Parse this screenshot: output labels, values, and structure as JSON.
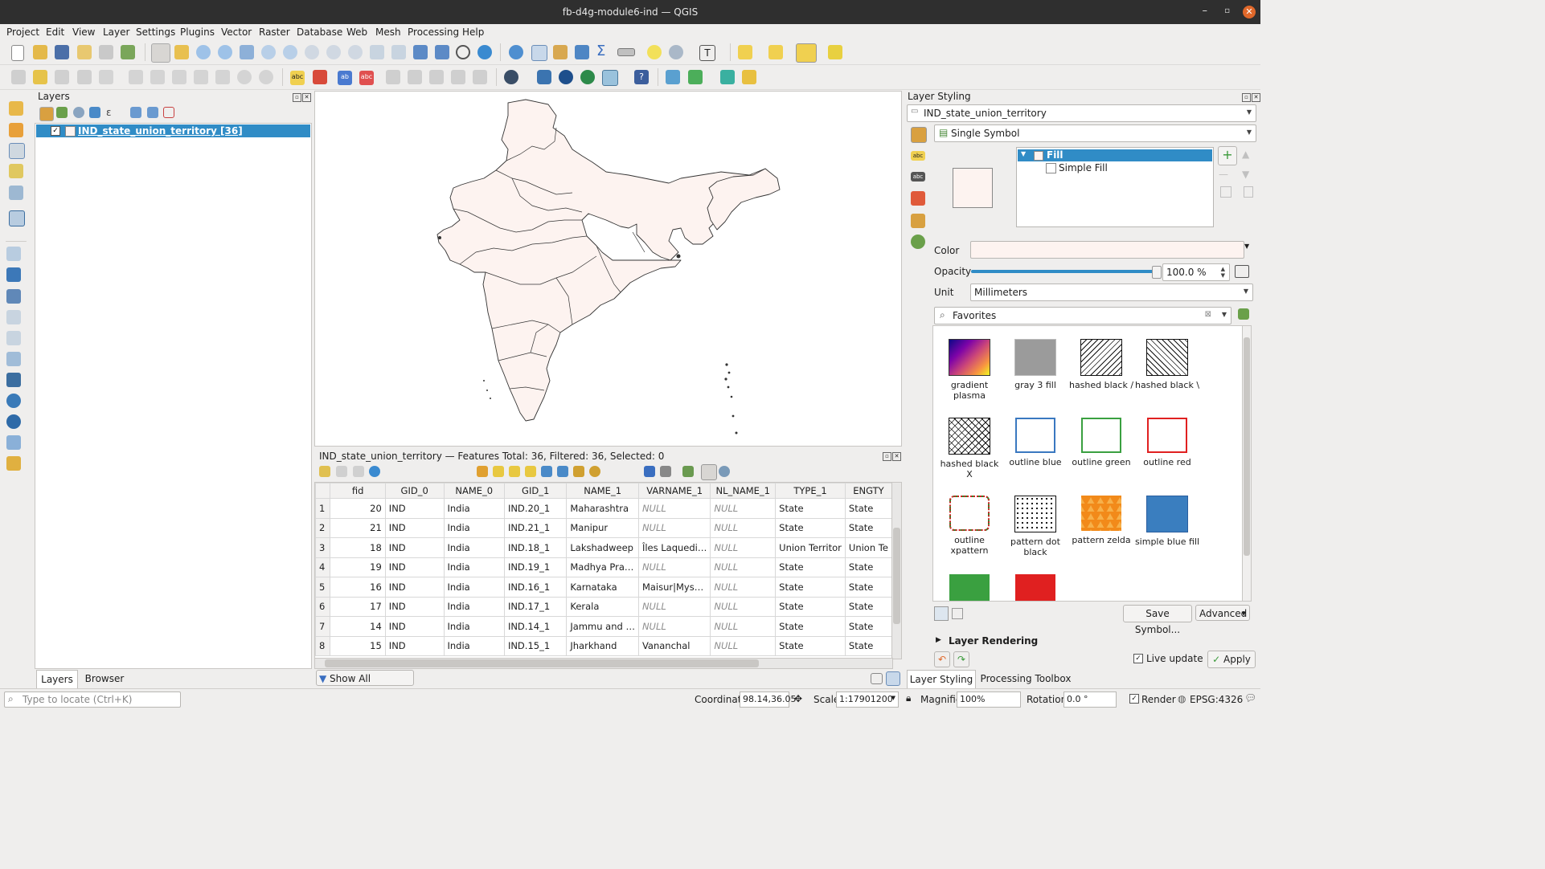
{
  "window": {
    "title": "fb-d4g-module6-ind — QGIS"
  },
  "menu": [
    "Project",
    "Edit",
    "View",
    "Layer",
    "Settings",
    "Plugins",
    "Vector",
    "Raster",
    "Database",
    "Web",
    "Mesh",
    "Processing",
    "Help"
  ],
  "layers_panel": {
    "title": "Layers",
    "layer_name": "IND_state_union_territory [36]",
    "tabs": [
      "Layers",
      "Browser"
    ]
  },
  "attribute_table": {
    "title": "IND_state_union_territory — Features Total: 36, Filtered: 36, Selected: 0",
    "columns": [
      "fid",
      "GID_0",
      "NAME_0",
      "GID_1",
      "NAME_1",
      "VARNAME_1",
      "NL_NAME_1",
      "TYPE_1",
      "ENGTY"
    ],
    "rows": [
      [
        "1",
        "20",
        "IND",
        "India",
        "IND.20_1",
        "Maharashtra",
        "NULL",
        "NULL",
        "State",
        "State"
      ],
      [
        "2",
        "21",
        "IND",
        "India",
        "IND.21_1",
        "Manipur",
        "NULL",
        "NULL",
        "State",
        "State"
      ],
      [
        "3",
        "18",
        "IND",
        "India",
        "IND.18_1",
        "Lakshadweep",
        "Îles Laquedi…",
        "NULL",
        "Union Territor",
        "Union Te"
      ],
      [
        "4",
        "19",
        "IND",
        "India",
        "IND.19_1",
        "Madhya Pra…",
        "NULL",
        "NULL",
        "State",
        "State"
      ],
      [
        "5",
        "16",
        "IND",
        "India",
        "IND.16_1",
        "Karnataka",
        "Maisur|Mys…",
        "NULL",
        "State",
        "State"
      ],
      [
        "6",
        "17",
        "IND",
        "India",
        "IND.17_1",
        "Kerala",
        "NULL",
        "NULL",
        "State",
        "State"
      ],
      [
        "7",
        "14",
        "IND",
        "India",
        "IND.14_1",
        "Jammu and …",
        "NULL",
        "NULL",
        "State",
        "State"
      ],
      [
        "8",
        "15",
        "IND",
        "India",
        "IND.15_1",
        "Jharkhand",
        "Vananchal",
        "NULL",
        "State",
        "State"
      ]
    ],
    "show_features_label": "Show All Features"
  },
  "styling": {
    "title": "Layer Styling",
    "layer": "IND_state_union_territory",
    "renderer": "Single Symbol",
    "tree_fill": "Fill",
    "tree_simple_fill": "Simple Fill",
    "color_label": "Color",
    "opacity_label": "Opacity",
    "opacity_value": "100.0 %",
    "opacity_fraction": 1.0,
    "unit_label": "Unit",
    "unit_value": "Millimeters",
    "search_value": "Favorites",
    "symbols": [
      {
        "label": "gradient plasma"
      },
      {
        "label": "gray 3 fill"
      },
      {
        "label": "hashed black /"
      },
      {
        "label": "hashed black \\"
      },
      {
        "label": "hashed black X"
      },
      {
        "label": "outline blue"
      },
      {
        "label": "outline green"
      },
      {
        "label": "outline red"
      },
      {
        "label": "outline xpattern"
      },
      {
        "label": "pattern dot black"
      },
      {
        "label": "pattern zelda"
      },
      {
        "label": "simple blue fill"
      }
    ],
    "save_symbol": "Save Symbol...",
    "advanced": "Advanced",
    "layer_rendering": "Layer Rendering",
    "live_update": "Live update",
    "apply": "Apply",
    "tabs": [
      "Layer Styling",
      "Processing Toolbox"
    ]
  },
  "status": {
    "locate_placeholder": "Type to locate (Ctrl+K)",
    "coordinate_label": "Coordinate",
    "coordinate_value": "98.14,36.05",
    "scale_label": "Scale",
    "scale_value": "1:17901200",
    "magnifier_label": "Magnifier",
    "magnifier_value": "100%",
    "rotation_label": "Rotation",
    "rotation_value": "0.0 °",
    "render_label": "Render",
    "crs": "EPSG:4326"
  },
  "colors": {
    "accent": "#308cc6",
    "fill": "#fdf3f0",
    "titlebar": "#2f2f2f"
  }
}
